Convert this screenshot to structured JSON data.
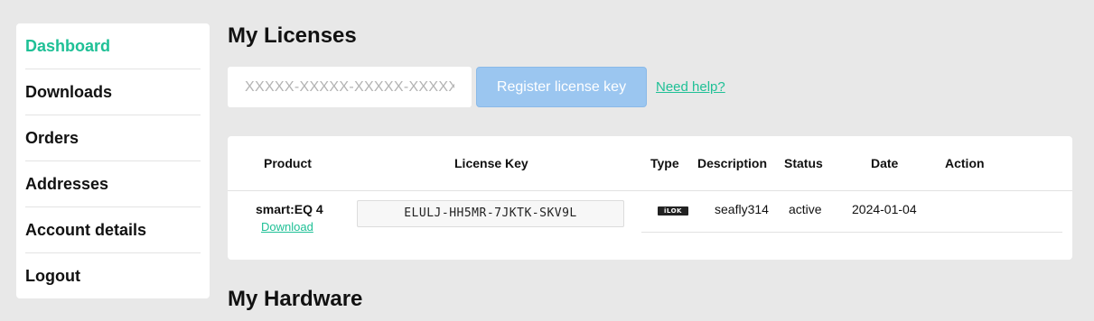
{
  "sidebar": {
    "items": [
      {
        "label": "Dashboard",
        "active": true
      },
      {
        "label": "Downloads"
      },
      {
        "label": "Orders"
      },
      {
        "label": "Addresses"
      },
      {
        "label": "Account details"
      },
      {
        "label": "Logout"
      }
    ]
  },
  "licenses": {
    "title": "My Licenses",
    "input_placeholder": "XXXXX-XXXXX-XXXXX-XXXXX",
    "register_label": "Register license key",
    "help_label": "Need help?"
  },
  "table": {
    "headers": {
      "product": "Product",
      "license_key": "License Key",
      "type": "Type",
      "description": "Description",
      "status": "Status",
      "date": "Date",
      "action": "Action"
    },
    "rows": [
      {
        "product": "smart:EQ 4",
        "download_label": "Download",
        "license_key": "ELULJ-HH5MR-7JKTK-SKV9L",
        "type_icon": "ilok-icon",
        "description": "seafly314",
        "status": "active",
        "date": "2024-01-04",
        "action": ""
      }
    ]
  },
  "hardware": {
    "title": "My Hardware"
  },
  "colors": {
    "accent": "#1fc096",
    "button": "#9bc6f0",
    "background": "#e8e8e8"
  }
}
